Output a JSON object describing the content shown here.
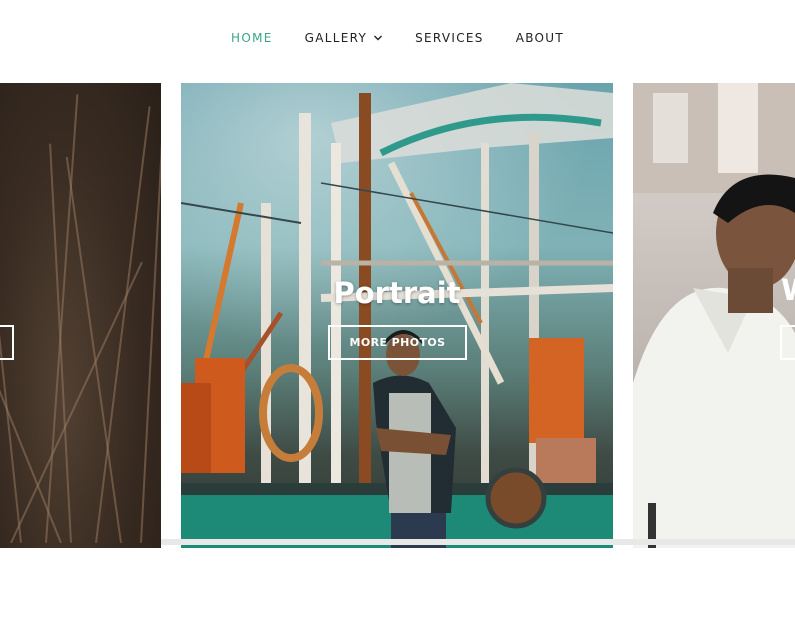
{
  "nav": {
    "items": [
      {
        "label": "HOME",
        "active": true
      },
      {
        "label": "GALLERY",
        "dropdown": true
      },
      {
        "label": "SERVICES"
      },
      {
        "label": "ABOUT"
      }
    ]
  },
  "slider": {
    "slides": [
      {
        "caption": "",
        "button": ""
      },
      {
        "caption": "Portrait",
        "button": "MORE PHOTOS"
      },
      {
        "caption": "W",
        "button": ""
      }
    ]
  },
  "colors": {
    "accent": "#3aa58a",
    "nav_text": "#222222"
  },
  "icons": {
    "gallery_dropdown": "chevron-down-icon"
  }
}
